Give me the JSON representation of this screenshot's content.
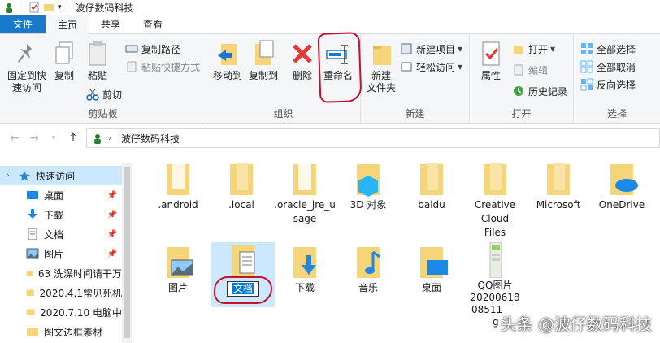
{
  "window": {
    "title": "波仔数码科技"
  },
  "tabs": [
    {
      "label": "文件"
    },
    {
      "label": "主页"
    },
    {
      "label": "共享"
    },
    {
      "label": "查看"
    }
  ],
  "ribbon": {
    "clipboard": {
      "label": "剪贴板",
      "pin_quick": "固定到快",
      "pin_quick2": "速访问",
      "copy": "复制",
      "paste": "粘贴",
      "copy_path": "复制路径",
      "paste_shortcut": "粘贴快捷方式",
      "cut": "剪切"
    },
    "organize": {
      "label": "组织",
      "move_to": "移动到",
      "copy_to": "复制到",
      "delete": "删除",
      "rename": "重命名"
    },
    "new": {
      "label": "新建",
      "new_folder": "新建",
      "new_folder2": "文件夹",
      "new_item": "新建项目",
      "easy_access": "轻松访问"
    },
    "open": {
      "label": "打开",
      "properties": "属性",
      "open": "打开",
      "edit": "编辑",
      "history": "历史记录"
    },
    "select": {
      "label": "选择",
      "select_all": "全部选择",
      "select_none": "全部取消",
      "invert": "反向选择"
    }
  },
  "address": {
    "path": "波仔数码科技"
  },
  "nav": {
    "items": [
      {
        "label": "快速访问"
      },
      {
        "label": "桌面"
      },
      {
        "label": "下载"
      },
      {
        "label": "文档"
      },
      {
        "label": "图片"
      },
      {
        "label": "63 洗澡时间请干万"
      },
      {
        "label": "2020.4.1常见死机"
      },
      {
        "label": "2020.7.10 电脑中"
      },
      {
        "label": "图文边框素材"
      }
    ]
  },
  "files": [
    {
      "name": ".android"
    },
    {
      "name": ".local"
    },
    {
      "name": ".oracle_jre_usage"
    },
    {
      "name": "3D 对象"
    },
    {
      "name": "baidu"
    },
    {
      "name": "Creative Cloud Files"
    },
    {
      "name": "Microsoft"
    },
    {
      "name": "OneDrive"
    },
    {
      "name": "图片"
    },
    {
      "name": "文档"
    },
    {
      "name": "下载"
    },
    {
      "name": "音乐"
    },
    {
      "name": "桌面"
    },
    {
      "name": "QQ图片20200618085111.jpg"
    }
  ],
  "qq_label": {
    "l1": "QQ图片",
    "l2": "20200618",
    "l3": "08511",
    "l4": "g"
  },
  "watermark": "头条 @波仔数码科技",
  "colors": {
    "file_tab": "#1979ca",
    "selection": "#cce8ff",
    "annotation": "#c8102e",
    "folder": "#f6d47a"
  }
}
